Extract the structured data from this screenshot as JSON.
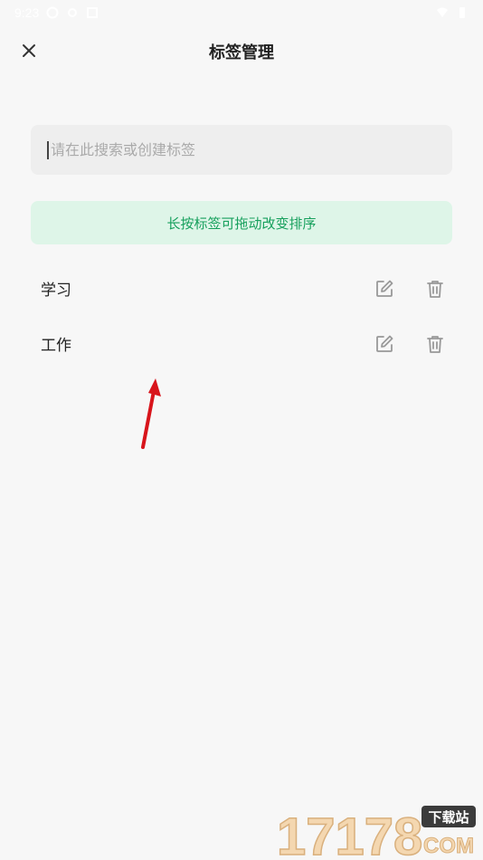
{
  "status_bar": {
    "time": "9:23"
  },
  "header": {
    "title": "标签管理",
    "close_icon": "close-icon"
  },
  "search": {
    "placeholder": "请在此搜索或创建标签",
    "value": ""
  },
  "hint": {
    "text": "长按标签可拖动改变排序"
  },
  "tags": [
    {
      "name": "学习",
      "edit_icon": "edit-icon",
      "delete_icon": "trash-icon"
    },
    {
      "name": "工作",
      "edit_icon": "edit-icon",
      "delete_icon": "trash-icon"
    }
  ],
  "watermark": {
    "number": "17178",
    "label": "下载站",
    "domain": "COM"
  },
  "colors": {
    "background": "#f7f7f7",
    "search_bg": "#eeeeee",
    "hint_bg": "#def5e8",
    "hint_text": "#17a05d",
    "icon_gray": "#999999",
    "annotation_arrow": "#d8141b"
  }
}
